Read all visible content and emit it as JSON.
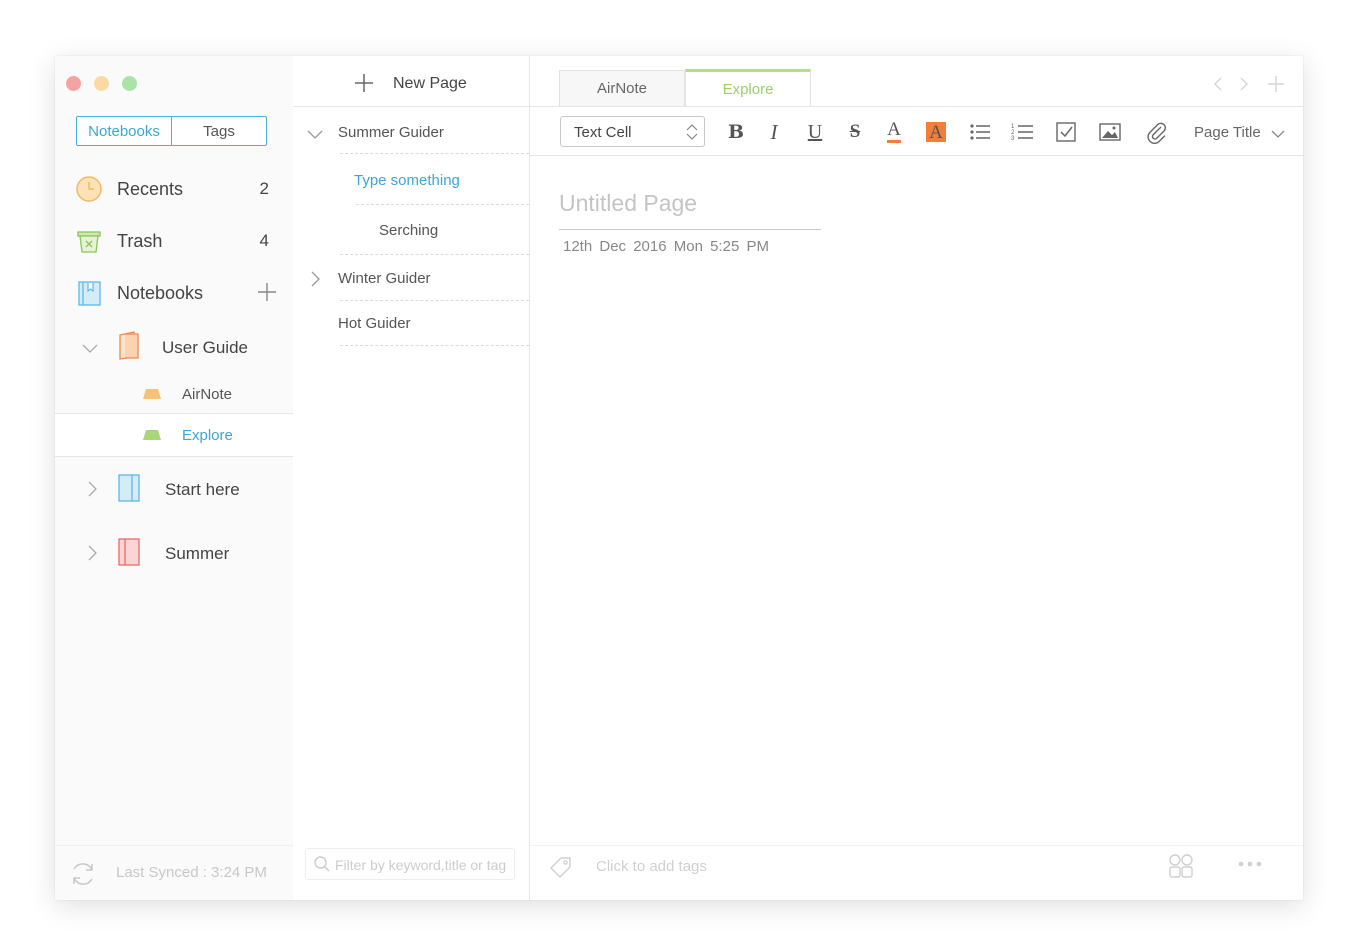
{
  "window": {
    "controls": [
      "close",
      "minimize",
      "zoom"
    ]
  },
  "sidebar": {
    "segment": {
      "notebooks": "Notebooks",
      "tags": "Tags",
      "selected": "Notebooks"
    },
    "recents": {
      "label": "Recents",
      "count": "2",
      "icon": "clock-icon"
    },
    "trash": {
      "label": "Trash",
      "count": "4",
      "icon": "trash-icon"
    },
    "notebooks": {
      "label": "Notebooks",
      "icon": "notebook-icon",
      "add_icon": "plus-icon"
    },
    "tree": {
      "user_guide": {
        "label": "User Guide",
        "expanded": true,
        "children": [
          {
            "label": "AirNote",
            "color": "#f5c27a"
          },
          {
            "label": "Explore",
            "color": "#a8d67a",
            "selected": true
          }
        ]
      },
      "start_here": {
        "label": "Start here",
        "color": "#5fb8e6"
      },
      "summer": {
        "label": "Summer",
        "color": "#ea6b6b"
      }
    },
    "footer": {
      "sync_text": "Last Synced : 3:24 PM",
      "icon": "sync-icon"
    }
  },
  "pagelist": {
    "new_page": "New Page",
    "items": {
      "summer_guider": "Summer Guider",
      "type_something": "Type something",
      "serching": "Serching",
      "winter_guider": "Winter Guider",
      "hot_guider": "Hot Guider"
    },
    "filter_placeholder": "Filter by keyword,title or tag"
  },
  "editor": {
    "tabs": [
      {
        "label": "AirNote",
        "active": false
      },
      {
        "label": "Explore",
        "active": true
      }
    ],
    "toolbar": {
      "cell_type": "Text Cell",
      "buttons": [
        "bold",
        "italic",
        "underline",
        "strikethrough",
        "font-color",
        "highlight",
        "bullet-list",
        "numbered-list",
        "checkbox",
        "image",
        "attachment"
      ],
      "bold_glyph": "B",
      "italic_glyph": "I",
      "underline_glyph": "U",
      "strike_glyph": "S",
      "color_glyph": "A",
      "highlight_glyph": "A",
      "page_title_select": "Page Title"
    },
    "document": {
      "title_placeholder": "Untitled Page",
      "date": "12th Dec 2016  Mon  5:25 PM"
    },
    "footer": {
      "tags_placeholder": "Click to add tags"
    }
  },
  "colors": {
    "accent_blue": "#3ba6d9",
    "accent_green": "#9ccf6c",
    "highlight_orange": "#ef7f3a"
  }
}
